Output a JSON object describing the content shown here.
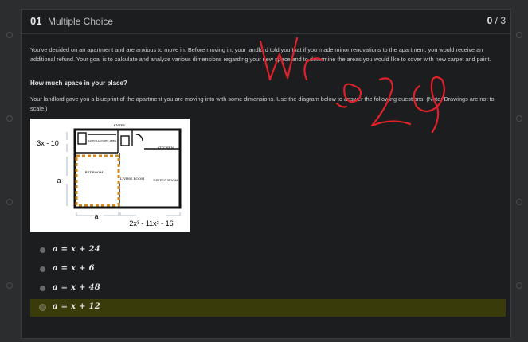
{
  "question": {
    "number": "01",
    "type": "Multiple Choice",
    "progress_current": "0",
    "progress_total": "/ 3"
  },
  "body": {
    "intro": "You've decided on an apartment and are anxious to move in. Before moving in, your landlord told you that if you made minor renovations to the apartment, you would receive an additional refund. Your goal is to calculate and analyze various dimensions regarding your new space and to determine the areas you would like to cover with new carpet and paint.",
    "subheading": "How much space in your place?",
    "instructions": "Your landlord gave you a blueprint of the apartment you are moving into with some dimensions. Use the diagram below to answer the following questions. (Note: Drawings are not to scale.)"
  },
  "diagram": {
    "label_top_left": "3x - 10",
    "label_left": "a",
    "label_bottom_left": "a",
    "label_bottom_right": "2x³ - 11x² - 16",
    "room_entry": "ENTRY",
    "room_bath": "BATH/ LAUNDRY AREA",
    "room_kitchen": "KITCHEN",
    "room_bedroom": "BEDROOM",
    "room_living": "LIVING ROOM",
    "room_dining": "DINING ROOM"
  },
  "choices": [
    {
      "label": "a = x + 24",
      "selected": false
    },
    {
      "label": "a = x + 6",
      "selected": false
    },
    {
      "label": "a = x + 48",
      "selected": false
    },
    {
      "label": "a = x + 12",
      "selected": true
    }
  ],
  "annotation": {
    "handwriting": "Wrong",
    "color": "#e0202a"
  },
  "colors": {
    "background": "#2b2d2f",
    "card": "#1c1d1f",
    "selected_choice": "#3a3b0a"
  }
}
